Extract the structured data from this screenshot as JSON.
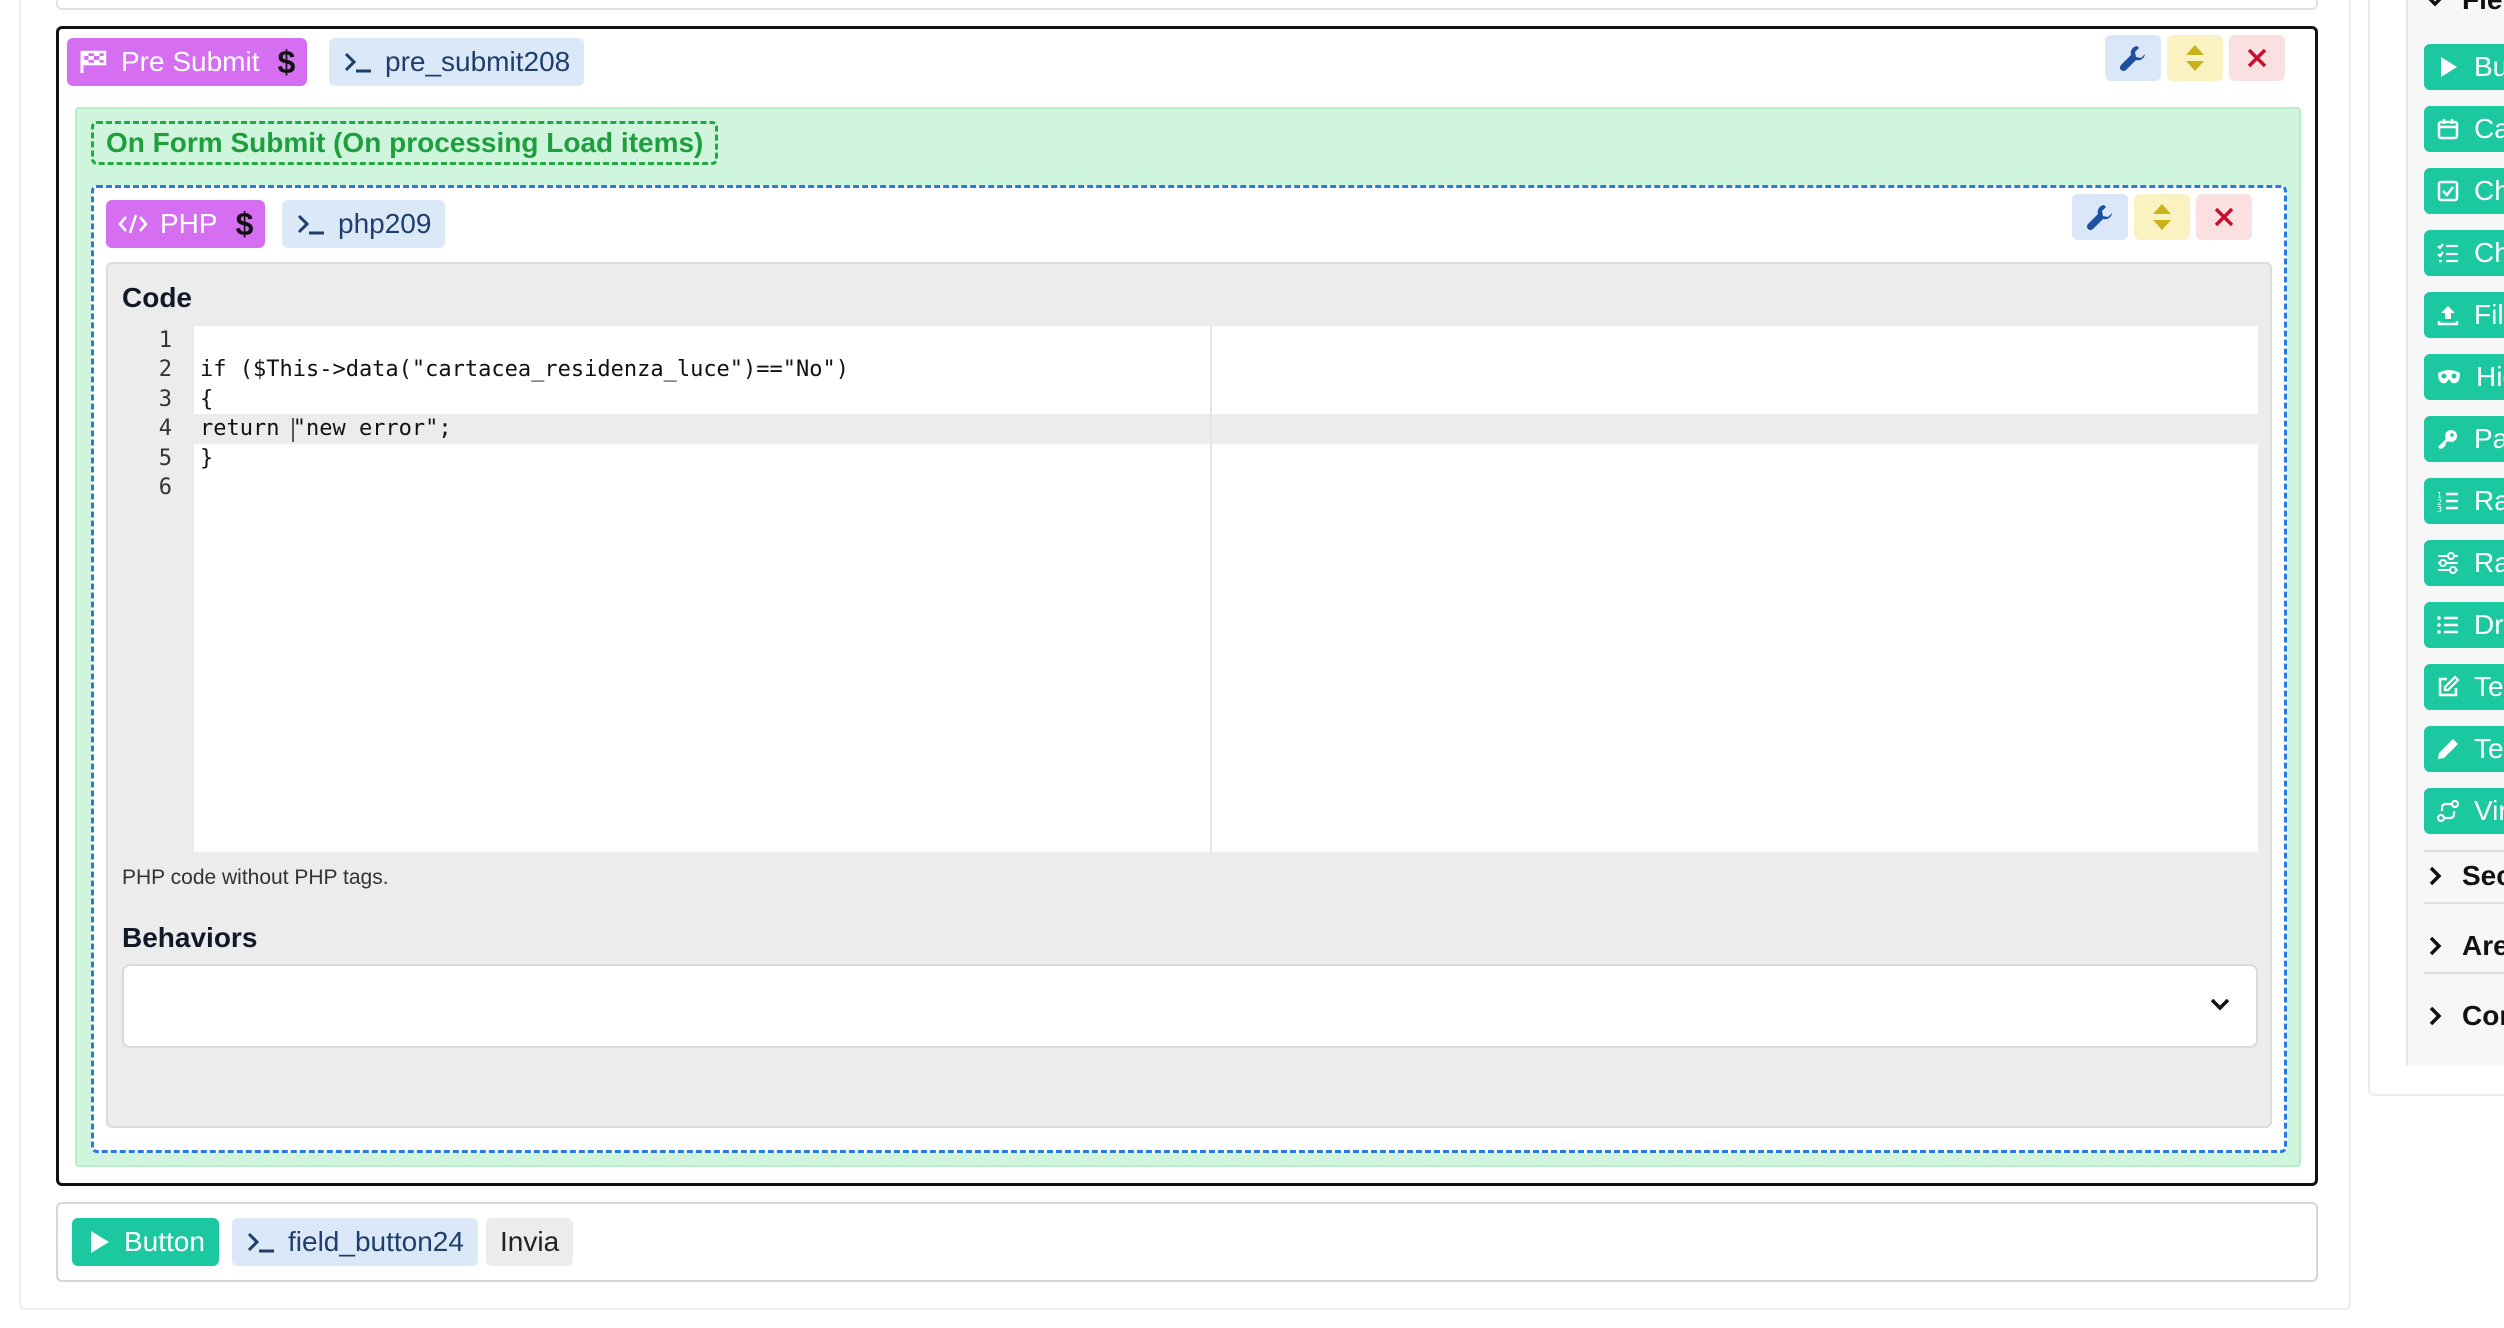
{
  "pre_submit": {
    "type_label": "Pre Submit",
    "id_label": "pre_submit208",
    "event_label": "On Form Submit (On processing Load items)"
  },
  "php": {
    "type_label": "PHP",
    "id_label": "php209",
    "code_label": "Code",
    "code_lines": [
      "",
      "if ($This->data(\"cartacea_residenza_luce\")==\"No\")",
      "{",
      "return \"new error\";",
      "}",
      ""
    ],
    "line_numbers": [
      "1",
      "2",
      "3",
      "4",
      "5",
      "6"
    ],
    "help_text": "PHP code without PHP tags.",
    "behaviors_label": "Behaviors",
    "behaviors_value": ""
  },
  "button_row": {
    "type_label": "Button",
    "id_label": "field_button24",
    "text_label": "Invia"
  },
  "sidebar": {
    "fields_header": "Fiel",
    "items": [
      {
        "label": "Bu",
        "icon": "play-icon"
      },
      {
        "label": "Ca",
        "icon": "calendar-icon"
      },
      {
        "label": "Ch",
        "icon": "checkbox-icon"
      },
      {
        "label": "Ch",
        "icon": "checklist-icon"
      },
      {
        "label": "Fil",
        "icon": "upload-icon"
      },
      {
        "label": "Hic",
        "icon": "mask-icon"
      },
      {
        "label": "Pa",
        "icon": "key-icon"
      },
      {
        "label": "Ra",
        "icon": "ordered-list-icon"
      },
      {
        "label": "Ra",
        "icon": "sliders-icon"
      },
      {
        "label": "Drc",
        "icon": "list-icon"
      },
      {
        "label": "Te",
        "icon": "edit-icon"
      },
      {
        "label": "Te",
        "icon": "pencil-icon"
      },
      {
        "label": "Vir",
        "icon": "route-icon"
      }
    ],
    "sections": [
      "Sec",
      "Are",
      "Con"
    ]
  },
  "colors": {
    "purple_tag": "#d66ef2",
    "green_field": "#1cc8a0",
    "event_bg": "#cff6dc",
    "event_border": "#23a843",
    "dashed_blue": "#2a78e4"
  }
}
